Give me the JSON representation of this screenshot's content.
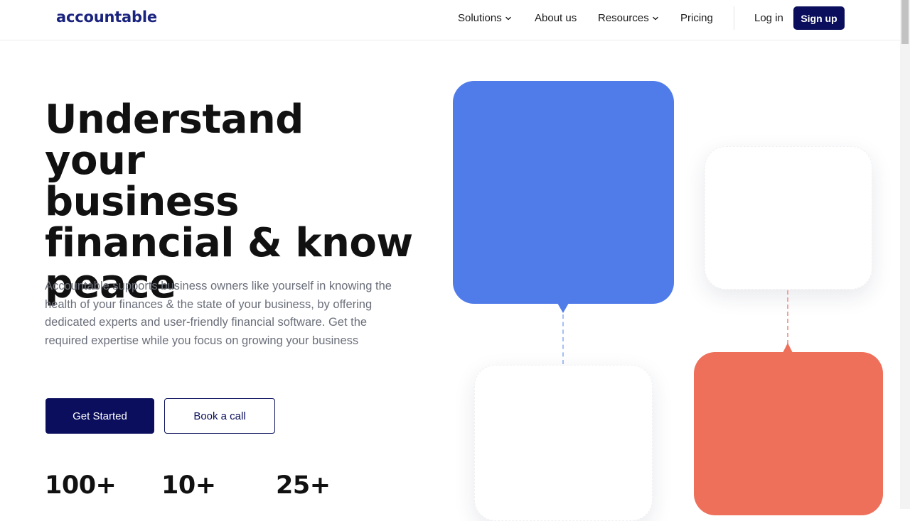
{
  "brand": {
    "logo_text": "accountable"
  },
  "nav": {
    "items": [
      {
        "label": "Solutions",
        "has_dropdown": true
      },
      {
        "label": "About us",
        "has_dropdown": false
      },
      {
        "label": "Resources",
        "has_dropdown": true
      },
      {
        "label": "Pricing",
        "has_dropdown": false
      }
    ],
    "login_label": "Log in",
    "signup_label": "Sign up"
  },
  "hero": {
    "title_lines": [
      "Understand your",
      "business",
      "financial & know",
      "peace"
    ],
    "description": "Accountable supports business owners like yourself in knowing the health of your finances & the state of your business, by offering dedicated experts and user-friendly financial software. Get the required expertise while you focus on growing your business",
    "primary_cta": "Get Started",
    "secondary_cta": "Book a call"
  },
  "stats": [
    {
      "value": "100+"
    },
    {
      "value": "10+"
    },
    {
      "value": "25+"
    }
  ],
  "colors": {
    "brand_navy": "#0a0e5c",
    "blue_card": "#507cea",
    "red_card": "#ee705b",
    "body_text": "#6b6f7a"
  },
  "icons": {
    "dropdown": "chevron-down-icon"
  }
}
